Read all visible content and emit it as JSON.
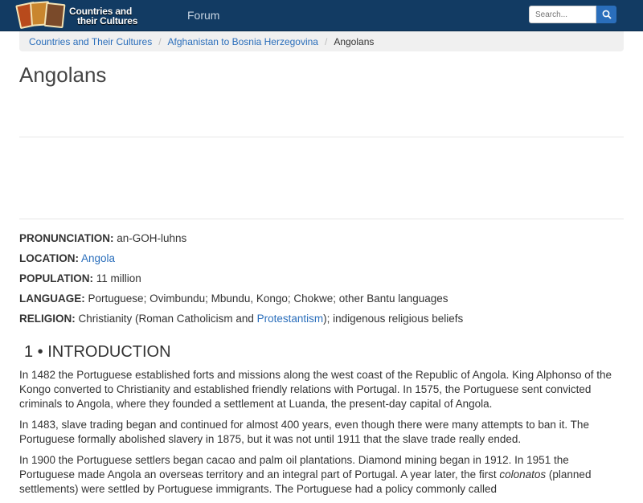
{
  "header": {
    "logo_line1": "Countries and",
    "logo_line2": "their Cultures",
    "nav_forum": "Forum",
    "search_placeholder": "Search..."
  },
  "breadcrumb": {
    "items": [
      "Countries and Their Cultures",
      "Afghanistan to Bosnia Herzegovina"
    ],
    "current": "Angolans"
  },
  "page": {
    "title": "Angolans"
  },
  "facts": {
    "pronunciation_label": "PRONUNCIATION:",
    "pronunciation_value": "an-GOH-luhns",
    "location_label": "LOCATION:",
    "location_link": "Angola",
    "population_label": "POPULATION:",
    "population_value": "11 million",
    "language_label": "LANGUAGE:",
    "language_value": "Portuguese; Ovimbundu; Mbundu, Kongo; Chokwe; other Bantu languages",
    "religion_label": "RELIGION:",
    "religion_pre": "Christianity (Roman Catholicism and ",
    "religion_link": "Protestantism",
    "religion_post": "); indigenous religious beliefs"
  },
  "section": {
    "heading": "1 • INTRODUCTION",
    "p1": "In 1482 the Portuguese established forts and missions along the west coast of the Republic of Angola. King Alphonso of the Kongo converted to Christianity and established friendly relations with Portugal. In 1575, the Portuguese sent convicted criminals to Angola, where they founded a settlement at Luanda, the present-day capital of Angola.",
    "p2": "In 1483, slave trading began and continued for almost 400 years, even though there were many attempts to ban it. The Portuguese formally abolished slavery in 1875, but it was not until 1911 that the slave trade really ended.",
    "p3_pre": "In 1900 the Portuguese settlers began cacao and palm oil plantations. Diamond mining began in 1912. In 1951 the Portuguese made Angola an overseas territory and an integral part of Portugal. A year later, the first ",
    "p3_italic": "colonatos",
    "p3_post": " (planned settlements) were settled by Portuguese immigrants. The Portuguese had a policy commonly called"
  },
  "colors": {
    "navbar": "#123b63",
    "link": "#2a6ebb",
    "breadcrumb_bg": "#f0f0f0"
  }
}
